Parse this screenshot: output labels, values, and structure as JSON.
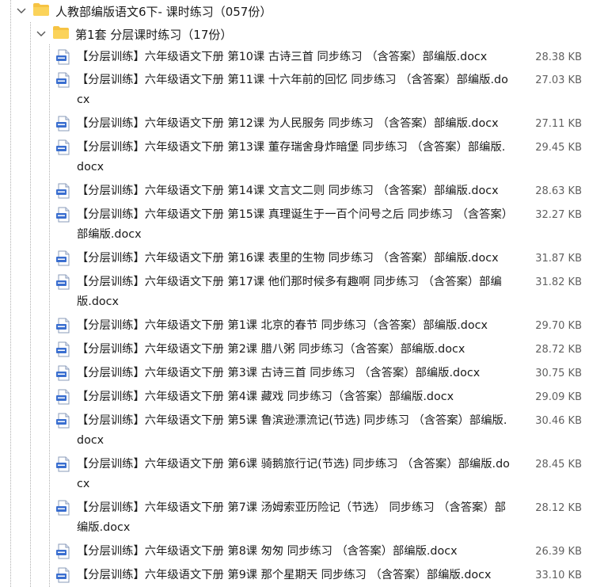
{
  "tree": {
    "root": {
      "label": "人教部编版语文6下- 课时练习（057份）",
      "expand_icon": "chevron-down-icon",
      "icon": "folder-icon"
    },
    "sub": {
      "label": "第1套 分层课时练习（17份）",
      "expand_icon": "chevron-down-icon",
      "icon": "folder-icon"
    },
    "files": [
      {
        "name": "【分层训练】六年级语文下册 第10课 古诗三首 同步练习 （含答案）部编版.docx",
        "size": "28.38 KB"
      },
      {
        "name": "【分层训练】六年级语文下册 第11课 十六年前的回忆 同步练习 （含答案）部编版.docx",
        "size": "27.03 KB"
      },
      {
        "name": "【分层训练】六年级语文下册 第12课 为人民服务 同步练习 （含答案）部编版.docx",
        "size": "27.11 KB"
      },
      {
        "name": "【分层训练】六年级语文下册 第13课 董存瑞舍身炸暗堡 同步练习 （含答案）部编版.docx",
        "size": "29.45 KB"
      },
      {
        "name": "【分层训练】六年级语文下册 第14课 文言文二则 同步练习 （含答案）部编版.docx",
        "size": "28.63 KB"
      },
      {
        "name": "【分层训练】六年级语文下册 第15课 真理诞生于一百个问号之后 同步练习 （含答案）部编版.docx",
        "size": "32.27 KB"
      },
      {
        "name": "【分层训练】六年级语文下册 第16课 表里的生物 同步练习 （含答案）部编版.docx",
        "size": "31.87 KB"
      },
      {
        "name": "【分层训练】六年级语文下册 第17课 他们那时候多有趣啊 同步练习 （含答案）部编版.docx",
        "size": "31.82 KB"
      },
      {
        "name": "【分层训练】六年级语文下册 第1课 北京的春节 同步练习（含答案）部编版.docx",
        "size": "29.70 KB"
      },
      {
        "name": "【分层训练】六年级语文下册 第2课 腊八粥 同步练习（含答案）部编版.docx",
        "size": "28.72 KB"
      },
      {
        "name": "【分层训练】六年级语文下册 第3课 古诗三首 同步练习 （含答案）部编版.docx",
        "size": "30.75 KB"
      },
      {
        "name": "【分层训练】六年级语文下册 第4课 藏戏 同步练习（含答案）部编版.docx",
        "size": "29.09 KB"
      },
      {
        "name": "【分层训练】六年级语文下册 第5课 鲁滨逊漂流记(节选) 同步练习 （含答案）部编版.docx",
        "size": "30.46 KB"
      },
      {
        "name": "【分层训练】六年级语文下册 第6课 骑鹅旅行记(节选) 同步练习 （含答案）部编版.docx",
        "size": "28.45 KB"
      },
      {
        "name": "【分层训练】六年级语文下册 第7课 汤姆索亚历险记（节选） 同步练习 （含答案）部编版.docx",
        "size": "28.12 KB"
      },
      {
        "name": "【分层训练】六年级语文下册 第8课 匆匆 同步练习 （含答案）部编版.docx",
        "size": "26.39 KB"
      },
      {
        "name": "【分层训练】六年级语文下册 第9课 那个星期天 同步练习 （含答案）部编版.docx",
        "size": "33.10 KB"
      }
    ]
  },
  "colors": {
    "folder": "#f6c343",
    "folder_dark": "#e0a82e",
    "doc_icon_blue": "#3b6fd0",
    "size_text": "#606060"
  }
}
